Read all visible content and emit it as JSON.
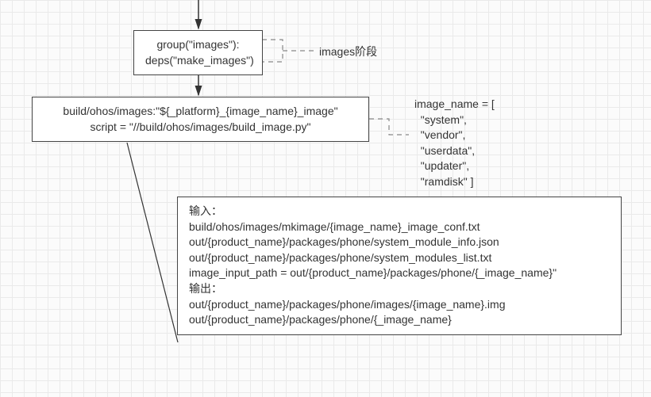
{
  "box1": {
    "line1": "group(\"images\"):",
    "line2": "deps(\"make_images\")"
  },
  "box2": {
    "line1": "build/ohos/images:\"${_platform}_{image_name}_image\"",
    "line2": "script = \"//build/ohos/images/build_image.py\""
  },
  "label_images_stage": "images阶段",
  "image_name_block": "image_name = [\n  \"system\",\n  \"vendor\",\n  \"userdata\",\n  \"updater\",\n  \"ramdisk\" ]",
  "io_box": {
    "l1": "输入：",
    "l2": "build/ohos/images/mkimage/{image_name}_image_conf.txt",
    "l3": "out/{product_name}/packages/phone/system_module_info.json",
    "l4": "out/{product_name}/packages/phone/system_modules_list.txt",
    "l5": "image_input_path = out/{product_name}/packages/phone/{_image_name}\"",
    "l6": "输出：",
    "l7": "out/{product_name}/packages/phone/images/{image_name}.img",
    "l8": "out/{product_name}/packages/phone/{_image_name}"
  }
}
